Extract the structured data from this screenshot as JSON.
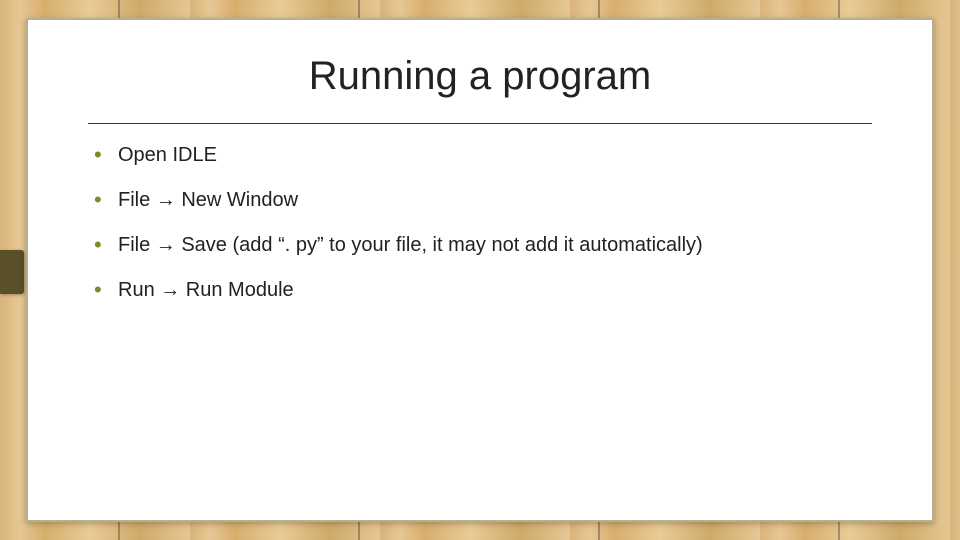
{
  "slide": {
    "title": "Running a program",
    "bullets": [
      "Open IDLE",
      "File → New Window",
      "File → Save (add “. py” to your file, it may not add it automatically)",
      "Run → Run Module"
    ]
  }
}
